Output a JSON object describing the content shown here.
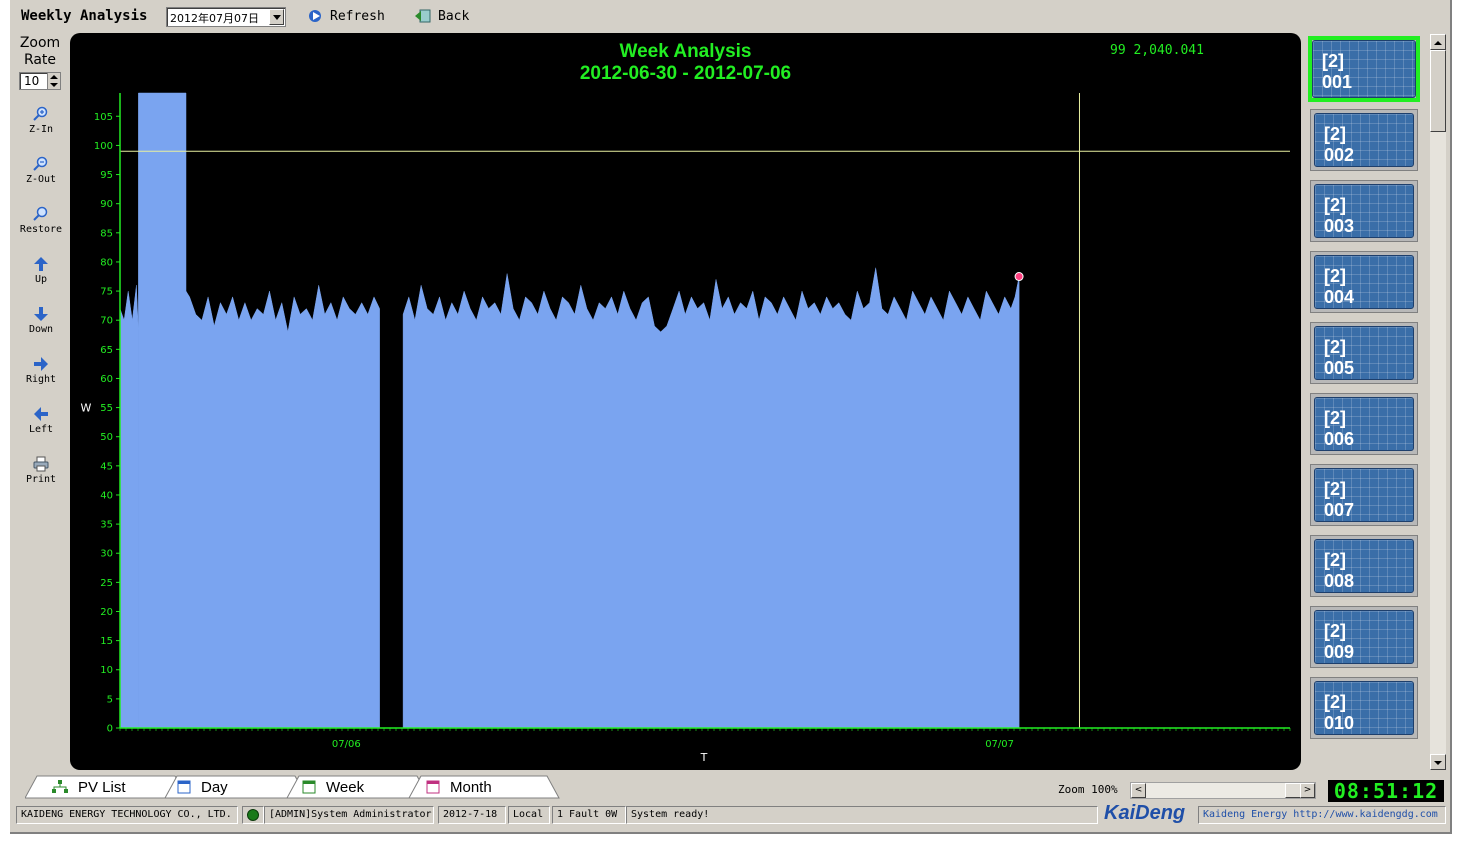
{
  "toolbar": {
    "title": "Weekly Analysis",
    "date_value": "2012年07月07日",
    "refresh_label": "Refresh",
    "back_label": "Back"
  },
  "left_tools": {
    "zoom_rate_label_1": "Zoom",
    "zoom_rate_label_2": "Rate",
    "zoom_rate_value": "10",
    "items": [
      {
        "label": "Z-In",
        "icon": "zoom-in-icon"
      },
      {
        "label": "Z-Out",
        "icon": "zoom-out-icon"
      },
      {
        "label": "Restore",
        "icon": "restore-icon"
      },
      {
        "label": "Up",
        "icon": "arrow-up-icon"
      },
      {
        "label": "Down",
        "icon": "arrow-down-icon"
      },
      {
        "label": "Right",
        "icon": "arrow-right-icon"
      },
      {
        "label": "Left",
        "icon": "arrow-left-icon"
      },
      {
        "label": "Print",
        "icon": "printer-icon"
      }
    ]
  },
  "chart_data": {
    "type": "area",
    "title": "Week Analysis",
    "subtitle": "2012-06-30 - 2012-07-06",
    "readout": "99 2,040.041",
    "xlabel": "T",
    "ylabel": "W",
    "ylim": [
      0,
      109
    ],
    "yticks": [
      0,
      5,
      10,
      15,
      20,
      25,
      30,
      35,
      40,
      45,
      50,
      55,
      60,
      65,
      70,
      75,
      80,
      85,
      90,
      95,
      100,
      105
    ],
    "xlim": [
      0,
      1
    ],
    "x_ticks": [
      {
        "x": 0.221,
        "label": "07/06"
      },
      {
        "x": 0.859,
        "label": "07/07"
      }
    ],
    "reference_y": 99,
    "cursor_x": 0.937,
    "end_marker": {
      "x": 0.878,
      "y": 77.5
    },
    "colors": {
      "fill": "#7aa4f0",
      "axis": "#22ee22",
      "reference": "#e8f0a0",
      "marker": "#ff4080"
    },
    "segments": [
      {
        "x": [
          0.0,
          0.004,
          0.008,
          0.012,
          0.016,
          0.018
        ],
        "y": [
          72,
          70,
          75,
          70,
          76,
          68
        ]
      },
      {
        "x": [
          0.018,
          0.0185,
          0.064,
          0.0645
        ],
        "y": [
          109,
          109,
          109,
          109
        ]
      },
      {
        "x": [
          0.0645,
          0.068,
          0.074,
          0.08,
          0.086,
          0.092,
          0.098,
          0.104,
          0.11,
          0.116,
          0.122,
          0.128,
          0.134,
          0.14,
          0.146,
          0.152,
          0.158,
          0.164,
          0.17,
          0.176,
          0.182,
          0.188,
          0.194,
          0.2,
          0.206,
          0.212,
          0.218,
          0.224,
          0.23,
          0.236,
          0.242,
          0.248,
          0.2535
        ],
        "y": [
          75,
          74,
          71,
          70,
          74,
          69,
          73,
          71,
          74,
          70,
          73,
          70,
          72,
          71,
          75,
          70,
          73,
          68,
          74,
          71,
          72,
          70,
          76,
          71,
          73,
          70,
          74,
          72,
          71,
          73,
          71,
          74,
          72
        ]
      },
      {
        "x": [
          0.2535,
          0.2545,
          0.2755,
          0.2765
        ],
        "y": [
          0,
          0,
          0,
          0
        ]
      },
      {
        "x": [
          0.2765,
          0.282,
          0.288,
          0.294,
          0.3,
          0.306,
          0.312,
          0.318,
          0.324,
          0.33,
          0.336,
          0.342,
          0.348,
          0.354,
          0.36,
          0.366,
          0.372,
          0.378,
          0.384,
          0.39,
          0.396,
          0.402,
          0.408,
          0.414,
          0.42,
          0.426,
          0.432,
          0.438,
          0.444,
          0.45,
          0.456,
          0.462,
          0.468,
          0.474,
          0.48,
          0.486,
          0.492,
          0.498,
          0.504,
          0.51,
          0.516,
          0.522,
          0.528,
          0.534,
          0.54,
          0.546,
          0.552,
          0.558,
          0.564,
          0.57,
          0.576,
          0.582,
          0.588,
          0.594,
          0.6,
          0.606,
          0.612,
          0.618,
          0.624,
          0.63,
          0.636,
          0.642,
          0.648,
          0.654,
          0.66,
          0.666,
          0.672,
          0.678,
          0.684,
          0.69,
          0.696,
          0.702,
          0.708,
          0.714,
          0.72,
          0.726,
          0.732,
          0.738,
          0.744,
          0.75,
          0.756,
          0.762,
          0.768,
          0.774,
          0.78,
          0.786,
          0.792,
          0.798,
          0.804,
          0.81,
          0.816,
          0.822,
          0.828,
          0.834,
          0.84,
          0.846,
          0.852,
          0.858,
          0.864,
          0.87,
          0.874,
          0.878
        ],
        "y": [
          71,
          74,
          70,
          76,
          72,
          71,
          74,
          70,
          73,
          71,
          75,
          72,
          70,
          74,
          72,
          73,
          71,
          78,
          72,
          70,
          74,
          73,
          71,
          75,
          72,
          70,
          74,
          73,
          71,
          76,
          72,
          70,
          73,
          72,
          74,
          71,
          75,
          72,
          70,
          73,
          74,
          69,
          68,
          69,
          72,
          75,
          71,
          74,
          72,
          73,
          70,
          77,
          72,
          74,
          71,
          73,
          72,
          75,
          70,
          74,
          73,
          71,
          74,
          72,
          70,
          75,
          72,
          73,
          71,
          74,
          72,
          73,
          71,
          70,
          75,
          72,
          73,
          79,
          72,
          71,
          74,
          72,
          70,
          75,
          73,
          71,
          74,
          72,
          70,
          75,
          73,
          71,
          74,
          72,
          70,
          75,
          73,
          71,
          74,
          72,
          74,
          77.5
        ]
      }
    ]
  },
  "devices": {
    "items": [
      {
        "line1": "[2]",
        "line2": "001",
        "selected": true
      },
      {
        "line1": "[2]",
        "line2": "002",
        "selected": false
      },
      {
        "line1": "[2]",
        "line2": "003",
        "selected": false
      },
      {
        "line1": "[2]",
        "line2": "004",
        "selected": false
      },
      {
        "line1": "[2]",
        "line2": "005",
        "selected": false
      },
      {
        "line1": "[2]",
        "line2": "006",
        "selected": false
      },
      {
        "line1": "[2]",
        "line2": "007",
        "selected": false
      },
      {
        "line1": "[2]",
        "line2": "008",
        "selected": false
      },
      {
        "line1": "[2]",
        "line2": "009",
        "selected": false
      },
      {
        "line1": "[2]",
        "line2": "010",
        "selected": false
      }
    ]
  },
  "tabs": [
    {
      "label": "PV List",
      "icon": "network-icon"
    },
    {
      "label": "Day",
      "icon": "calendar-day-icon"
    },
    {
      "label": "Week",
      "icon": "calendar-week-icon"
    },
    {
      "label": "Month",
      "icon": "calendar-month-icon"
    }
  ],
  "zoom": {
    "label": "Zoom 100%"
  },
  "clock": "08:51:12",
  "status": {
    "company": "KAIDENG ENERGY TECHNOLOGY CO., LTD.",
    "user": "[ADMIN]System Administrator",
    "date": "2012-7-18",
    "mode": "Local",
    "fault": "1 Fault  0W",
    "message": "System ready!",
    "brand": "KaiDeng",
    "website": "Kaideng Energy http://www.kaidengdg.com"
  }
}
